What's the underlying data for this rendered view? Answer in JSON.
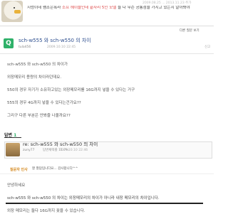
{
  "banner": {
    "question_prefix": "지렁이네 쌤조은폭라",
    "question_highlight": "소프 헤이블인데 끝자리 5인 모델",
    "question_suffix": "들 다 무슨 공통점을 가지고 있는지 알아봐야",
    "meta": "2009.08.25 ... 2013.11.23  추가"
  },
  "nav": {
    "other_questions": "다른 질문 보기"
  },
  "question": {
    "badge": "Q",
    "title": "sch-w555 와 sch-w550 의 차이",
    "author": "tula456",
    "date": "2009.10.10 22:45",
    "report": "신고",
    "lines": [
      "sch-w555 와 sch-w550 의 차이가",
      "외장메모리 용량의 차이라던데요.",
      "550의 경우 자기가 소유하고있는 외장메모리를 16G까지 넣을 수 있다는 거구",
      "555의 경우 4G까지 넣을 수 있다는건가요??",
      "그리구 다른 부분은 안봐줄 나올까요??"
    ]
  },
  "answers": {
    "label": "답변",
    "count": "1"
  },
  "answer": {
    "title": "re: sch-w555 와 sch-w550 의 차이",
    "author": "zuny77",
    "grade": "답변채택률 11.7%",
    "date": "2009.10.10 22:46",
    "greeting_label": "질문자 인사",
    "greeting_text": "잘 봤답입니다요...  감사합니다^^",
    "line1": "안녕하세요",
    "line2": "sch-w555 와 sch-w550 의 차이는 외장메모리의 차이가 아니라 내장 메모리의 차이입니다.",
    "line3": "외장 메모리는 둘다 16G까지 꽂을 수 있습니다."
  }
}
